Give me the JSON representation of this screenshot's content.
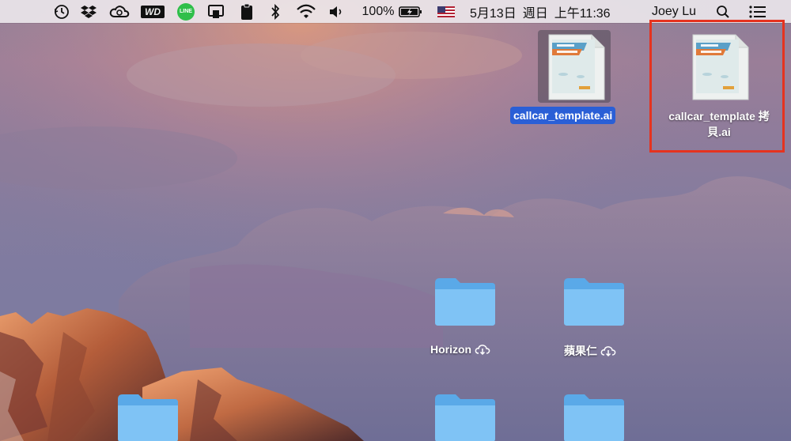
{
  "menubar": {
    "battery_percent": "100%",
    "date": "5月13日",
    "weekday": "週日",
    "time": "上午11:36",
    "user": "Joey Lu",
    "icons": [
      "time-machine-icon",
      "dropbox-icon",
      "creative-cloud-icon",
      "wd-icon",
      "line-icon",
      "airplay-icon",
      "clipboard-icon",
      "bluetooth-icon",
      "wifi-icon",
      "volume-icon",
      "battery-icon",
      "flag-icon",
      "search-icon",
      "menu-list-icon"
    ],
    "line_text": "LINE",
    "wd_text": "WD"
  },
  "desktop": {
    "files": [
      {
        "name": "callcar_template.ai",
        "selected": true
      },
      {
        "name_line1": "callcar_template 拷",
        "name_line2": "貝.ai",
        "selected": false
      }
    ],
    "folders": [
      {
        "name": "Horizon",
        "icon": "cloud-download-icon"
      },
      {
        "name": "蘋果仁",
        "icon": "cloud-download-icon"
      }
    ],
    "highlight_color": "#e5331f",
    "selection_color": "#2a5fd6",
    "folder_color": "#6fb9f2"
  }
}
